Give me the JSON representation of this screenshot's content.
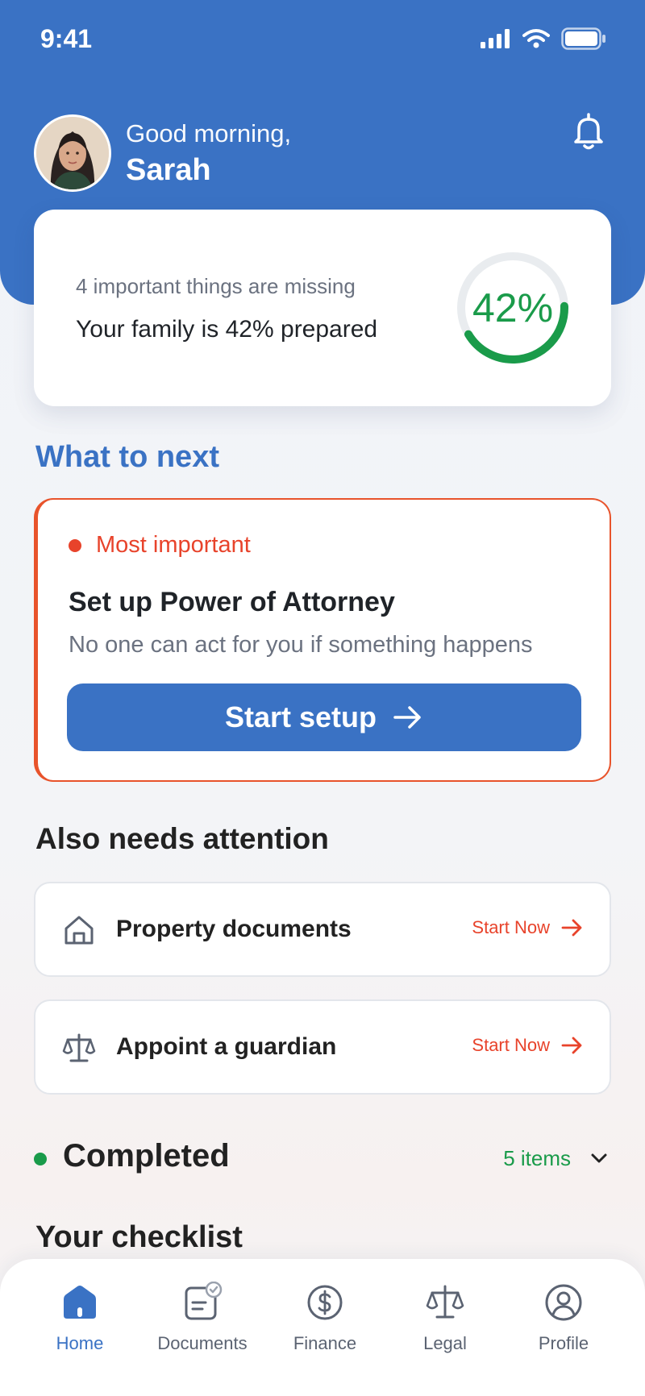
{
  "status_bar": {
    "time": "9:41"
  },
  "header": {
    "greeting": "Good morning,",
    "user_name": "Sarah"
  },
  "progress_card": {
    "missing_text": "4 important things are missing",
    "prepared_text": "Your family is 42% prepared",
    "percent_label": "42%",
    "percent_value": 42
  },
  "next_section": {
    "title": "What to next",
    "tag_label": "Most important",
    "task_title": "Set up Power of Attorney",
    "task_description": "No one can act for you if something happens",
    "button_label": "Start setup"
  },
  "attention_section": {
    "title": "Also needs attention",
    "items": [
      {
        "label": "Property documents",
        "action_label": "Start Now",
        "icon": "home-outline-icon"
      },
      {
        "label": "Appoint a guardian",
        "action_label": "Start Now",
        "icon": "scale-icon"
      }
    ]
  },
  "completed_section": {
    "label": "Completed",
    "count_label": "5 items"
  },
  "checklist_section": {
    "title": "Your checklist"
  },
  "tabbar": {
    "tabs": [
      {
        "label": "Home",
        "icon": "home-icon",
        "active": true
      },
      {
        "label": "Documents",
        "icon": "documents-icon",
        "active": false
      },
      {
        "label": "Finance",
        "icon": "dollar-icon",
        "active": false
      },
      {
        "label": "Legal",
        "icon": "scale-icon",
        "active": false
      },
      {
        "label": "Profile",
        "icon": "profile-icon",
        "active": false
      }
    ]
  },
  "colors": {
    "primary": "#3a72c4",
    "danger": "#e8432b",
    "success": "#1a9b4a",
    "muted_text": "#6b7280"
  }
}
